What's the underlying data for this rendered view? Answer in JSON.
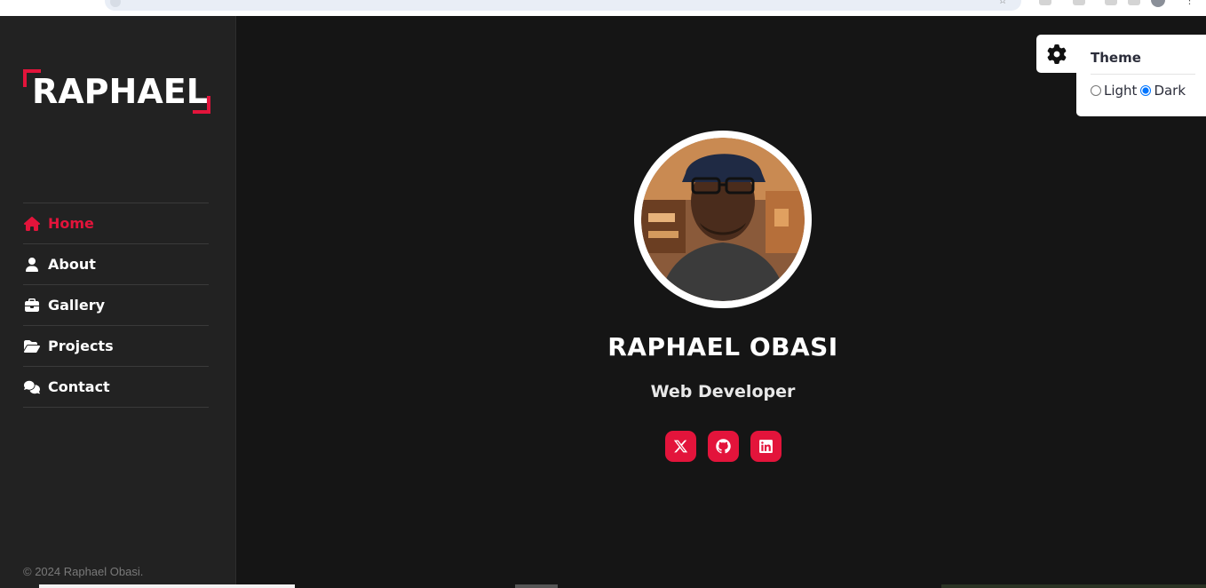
{
  "sidebar": {
    "logo_text": "RAPHAEL",
    "nav": [
      {
        "label": "Home",
        "icon": "home-icon",
        "active": true
      },
      {
        "label": "About",
        "icon": "user-icon",
        "active": false
      },
      {
        "label": "Gallery",
        "icon": "briefcase-icon",
        "active": false
      },
      {
        "label": "Projects",
        "icon": "folder-open-icon",
        "active": false
      },
      {
        "label": "Contact",
        "icon": "comments-icon",
        "active": false
      }
    ],
    "copyright": "© 2024 Raphael Obasi."
  },
  "hero": {
    "avatar_icon": "profile-photo",
    "name": "RAPHAEL OBASI",
    "role": "Web Developer",
    "socials": [
      {
        "icon": "x-twitter-icon"
      },
      {
        "icon": "github-icon"
      },
      {
        "icon": "linkedin-icon"
      }
    ]
  },
  "theme_switcher": {
    "title": "Theme",
    "options": [
      {
        "label": "Light",
        "selected": false
      },
      {
        "label": "Dark",
        "selected": true
      }
    ]
  },
  "colors": {
    "accent": "#e3143b",
    "background": "#151515",
    "sidebar": "#222222"
  }
}
